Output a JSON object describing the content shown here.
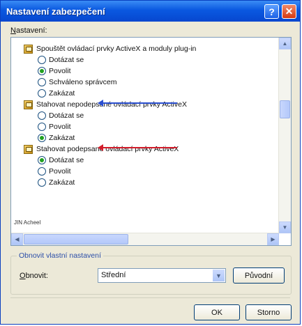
{
  "window": {
    "title": "Nastavení zabezpečení",
    "help_glyph": "?",
    "close_glyph": "✕"
  },
  "settings_label": {
    "accel": "N",
    "rest": "astavení:"
  },
  "tree": [
    {
      "kind": "category",
      "label": "Spouštět ovládací prvky ActiveX a moduly plug-in"
    },
    {
      "kind": "option",
      "label": "Dotázat se",
      "checked": false
    },
    {
      "kind": "option",
      "label": "Povolit",
      "checked": true
    },
    {
      "kind": "option",
      "label": "Schváleno správcem",
      "checked": false
    },
    {
      "kind": "option",
      "label": "Zakázat",
      "checked": false
    },
    {
      "kind": "category",
      "label": "Stahovat nepodepsané ovládací prvky ActiveX"
    },
    {
      "kind": "option",
      "label": "Dotázat se",
      "checked": false
    },
    {
      "kind": "option",
      "label": "Povolit",
      "checked": false
    },
    {
      "kind": "option",
      "label": "Zakázat",
      "checked": true
    },
    {
      "kind": "category",
      "label": "Stahovat podepsané ovládací prvky ActiveX"
    },
    {
      "kind": "option",
      "label": "Dotázat se",
      "checked": true
    },
    {
      "kind": "option",
      "label": "Povolit",
      "checked": false
    },
    {
      "kind": "option",
      "label": "Zakázat",
      "checked": false
    }
  ],
  "tree_cutoff_text": "JIN Acheel",
  "arrows": [
    {
      "color": "#2a4fd0"
    },
    {
      "color": "#d21d2b"
    }
  ],
  "reset_group": {
    "legend": "Obnovit vlastní nastavení",
    "label_accel": "O",
    "label_rest": "bnovit:",
    "select_value": "Střední",
    "reset_button": "Původní"
  },
  "buttons": {
    "ok": "OK",
    "cancel": "Storno"
  }
}
